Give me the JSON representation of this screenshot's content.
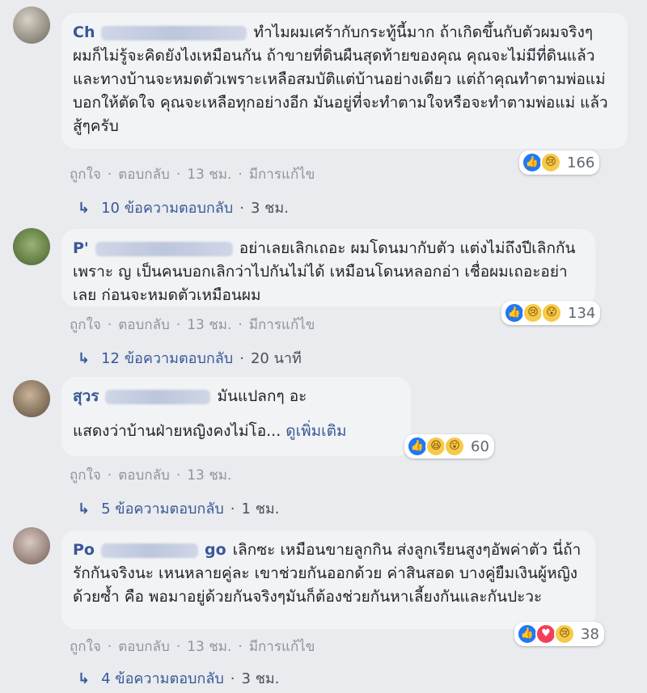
{
  "comments": [
    {
      "name": "Ch",
      "text": "ทำไมผมเศร้ากับกระทู้นี้มาก ถ้าเกิดขึ้นกับตัวผมจริงๆ ผมก็ไม่รู้จะคิดยังไงเหมือนกัน ถ้าขายที่ดินผืนสุดท้ายของคุณ คุณจะไม่มีที่ดินแล้วและทางบ้านจะหมดตัวเพราะเหลือสมบัติแต่บ้านอย่างเดียว แต่ถ้าคุณทำตามพ่อแม่บอกให้ตัดใจ คุณจะเหลือทุกอย่างอีก มันอยู่ที่จะทำตามใจหรือจะทำตามพ่อแม่ แล้วสู้ๆครับ",
      "reaction_count": "166",
      "reactions": [
        "like",
        "sad"
      ],
      "like": "ถูกใจ",
      "reply": "ตอบกลับ",
      "time": "13 ชม.",
      "edited": "มีการแก้ไข",
      "replies_label": "10 ข้อความตอบกลับ",
      "replies_time": "3 ชม."
    },
    {
      "name": "P'",
      "text": "อย่าเลยเลิกเถอะ ผมโดนมากับตัว แต่งไม่ถึงปีเลิกกันเพราะ ญ เป็นคนบอกเลิกว่าไปกันไม่ได้ เหมือนโดนหลอกอ่า เชื่อผมเถอะอย่าเลย ก่อนจะหมดตัวเหมือนผม",
      "reaction_count": "134",
      "reactions": [
        "like",
        "sad",
        "wow"
      ],
      "like": "ถูกใจ",
      "reply": "ตอบกลับ",
      "time": "13 ชม.",
      "edited": "มีการแก้ไข",
      "replies_label": "12 ข้อความตอบกลับ",
      "replies_time": "20 นาที"
    },
    {
      "name": "สุวร",
      "text_line1": "มันแปลกๆ อะ",
      "text_line2": "แสดงว่าบ้านฝ่ายหญิงคงไม่โอ...",
      "see_more": "ดูเพิ่มเติม",
      "reaction_count": "60",
      "reactions": [
        "like",
        "haha",
        "wow"
      ],
      "like": "ถูกใจ",
      "reply": "ตอบกลับ",
      "time": "13 ชม.",
      "replies_label": "5 ข้อความตอบกลับ",
      "replies_time": "1 ชม."
    },
    {
      "name": "Po",
      "name_suffix": "go",
      "text": "เลิกซะ เหมือนขายลูกกิน ส่งลูกเรียนสูงๆอัพค่าตัว นี่ถ้ารักกันจริงนะ เหนหลายคู่ละ เขาช่วยกันออกด้วย ค่าสินสอด บางคู่ยืมเงินผู้หญิงด้วยซ้ำ คือ พอมาอยู่ด้วยกันจริงๆมันก็ต้องช่วยกันหาเลี้ยงกันและกันปะวะ",
      "reaction_count": "38",
      "reactions": [
        "like",
        "love",
        "sad"
      ],
      "like": "ถูกใจ",
      "reply": "ตอบกลับ",
      "time": "13 ชม.",
      "edited": "มีการแก้ไข",
      "replies_label": "4 ข้อความตอบกลับ",
      "replies_time": "3 ชม."
    }
  ]
}
